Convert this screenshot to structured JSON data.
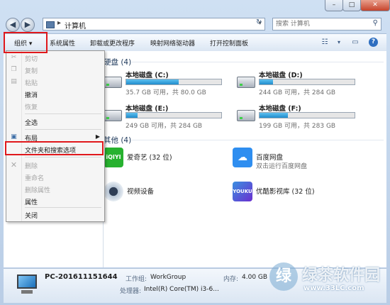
{
  "window": {
    "caption_buttons": {
      "minimize": "–",
      "maximize": "□",
      "close": "✕"
    }
  },
  "address_bar": {
    "separator": "▸",
    "crumb": "计算机",
    "dropdown": "▾",
    "refresh": "↻"
  },
  "search": {
    "placeholder": "搜索 计算机"
  },
  "toolbar": {
    "organize": "组织 ▾",
    "system_properties": "系统属性",
    "uninstall": "卸载或更改程序",
    "map_drive": "映射网络驱动器",
    "control_panel": "打开控制面板",
    "help": "?"
  },
  "content": {
    "group_drives": "硬盘 (4)",
    "drives": [
      {
        "name": "本地磁盘 (C:)",
        "info": "35.7 GB 可用，共 80.0 GB",
        "used_fraction": 0.55
      },
      {
        "name": "本地磁盘 (D:)",
        "info": "244 GB 可用，共 284 GB",
        "used_fraction": 0.14
      },
      {
        "name": "本地磁盘 (E:)",
        "info": "249 GB 可用，共 284 GB",
        "used_fraction": 0.12
      },
      {
        "name": "本地磁盘 (F:)",
        "info": "199 GB 可用，共 283 GB",
        "used_fraction": 0.3
      }
    ],
    "group_other": "其他 (4)",
    "others": [
      {
        "name": "爱奇艺 (32 位)",
        "sub": ""
      },
      {
        "name": "百度网盘",
        "sub": "双击运行百度网盘"
      },
      {
        "name": "视频设备",
        "sub": ""
      },
      {
        "name": "优酷影视库 (32 位)",
        "sub": ""
      }
    ]
  },
  "menu": {
    "cut": "剪切",
    "copy": "复制",
    "paste": "粘贴",
    "undo": "撤消",
    "redo": "恢复",
    "select_all": "全选",
    "layout": "布局",
    "folder_options": "文件夹和搜索选项",
    "delete": "删除",
    "rename": "重命名",
    "remove_properties": "删除属性",
    "properties": "属性",
    "close": "关闭"
  },
  "details": {
    "pc_name": "PC-201611151644",
    "workgroup_label": "工作组:",
    "workgroup_value": "WorkGroup",
    "memory_label": "内存:",
    "memory_value": "4.00 GB",
    "processor_label": "处理器:",
    "processor_value": "Intel(R) Core(TM) i3-6..."
  },
  "watermark": {
    "logo": "绿",
    "text": "绿茶软件园",
    "url": "www.33LC.com"
  },
  "colors": {
    "highlight_box": "#e0181c",
    "drive_bar": "#1f8ccd",
    "group_header": "#1e395b"
  }
}
